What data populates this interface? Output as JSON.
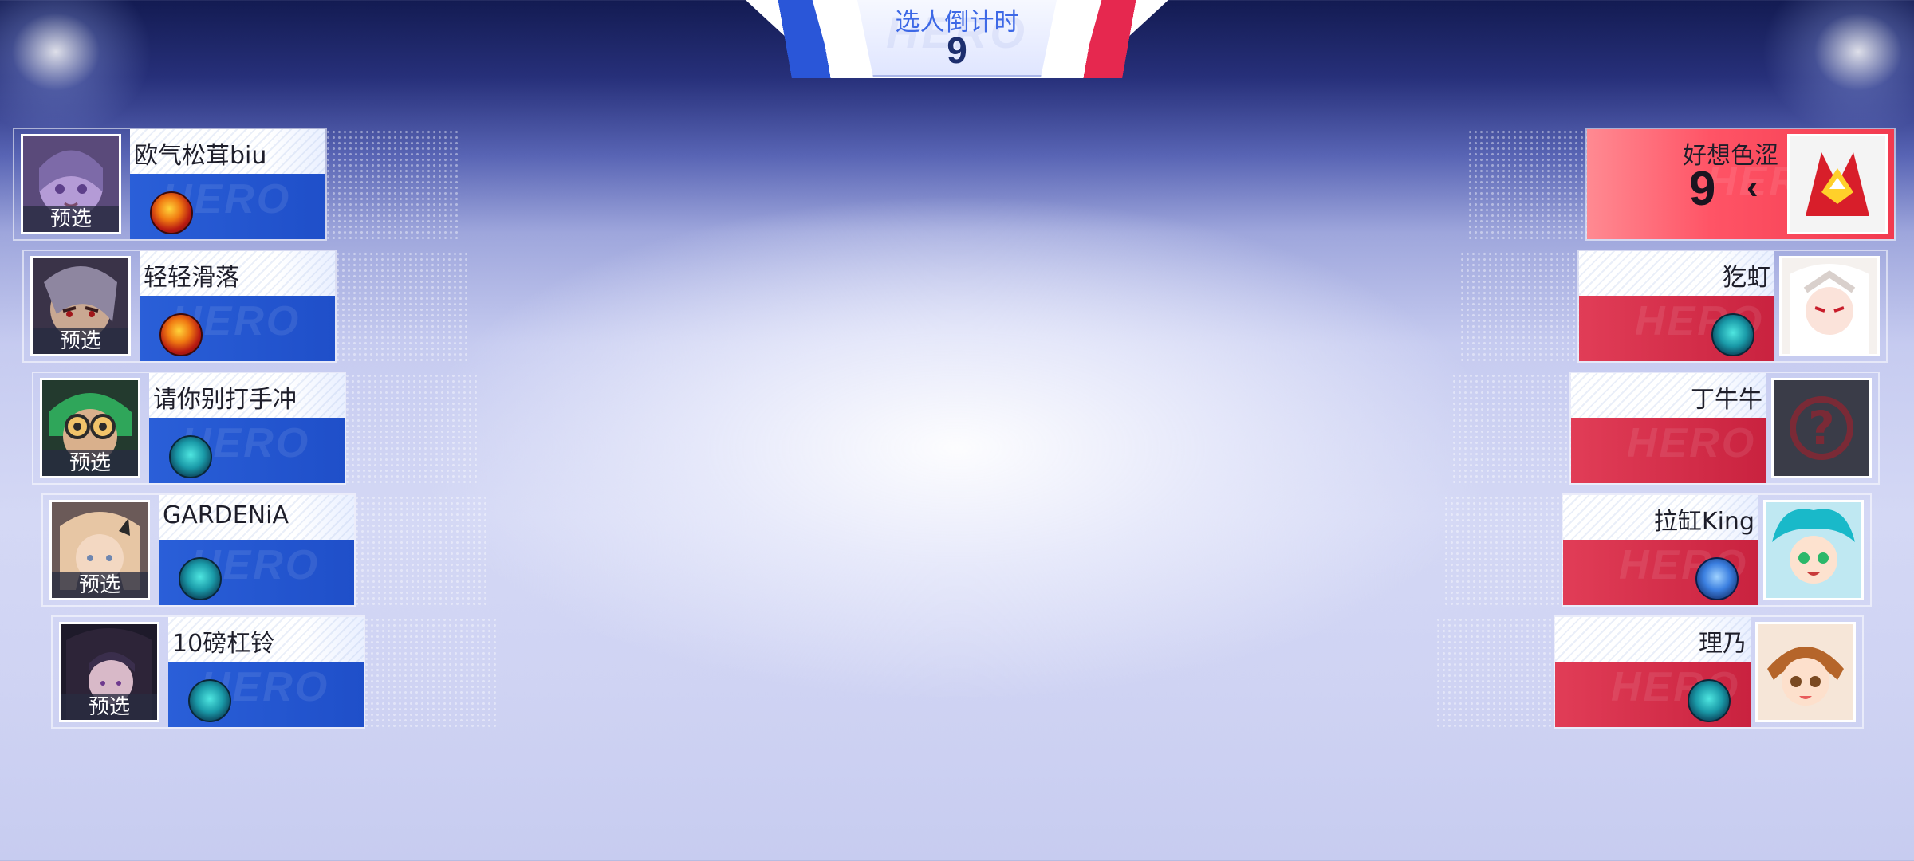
{
  "timer": {
    "label": "选人倒计时",
    "count": "9"
  },
  "watermark": "HERO",
  "preselect_label": "预选",
  "blue_team": [
    {
      "name": "欧气松茸biu",
      "status": "预选",
      "spell": "flash-spell-icon"
    },
    {
      "name": "轻轻滑落",
      "status": "预选",
      "spell": "flash-spell-icon"
    },
    {
      "name": "请你别打手冲",
      "status": "预选",
      "spell": "sprint-spell-icon"
    },
    {
      "name": "GARDENiA",
      "status": "预选",
      "spell": "sprint-spell-icon"
    },
    {
      "name": "10磅杠铃",
      "status": "预选",
      "spell": "sprint-spell-icon"
    }
  ],
  "red_team": [
    {
      "name": "好想色涩",
      "countdown": "9",
      "active": true
    },
    {
      "name": "犵虰",
      "spell": "sprint-spell-icon"
    },
    {
      "name": "丁牛牛",
      "portrait": "unknown-hero-icon"
    },
    {
      "name": "拉缸King",
      "spell": "ice-spell-icon"
    },
    {
      "name": "理乃",
      "spell": "sprint-spell-icon"
    }
  ],
  "colors": {
    "blue": "#2a5fd8",
    "red": "#e13d57",
    "active_red": "#ff5466"
  }
}
